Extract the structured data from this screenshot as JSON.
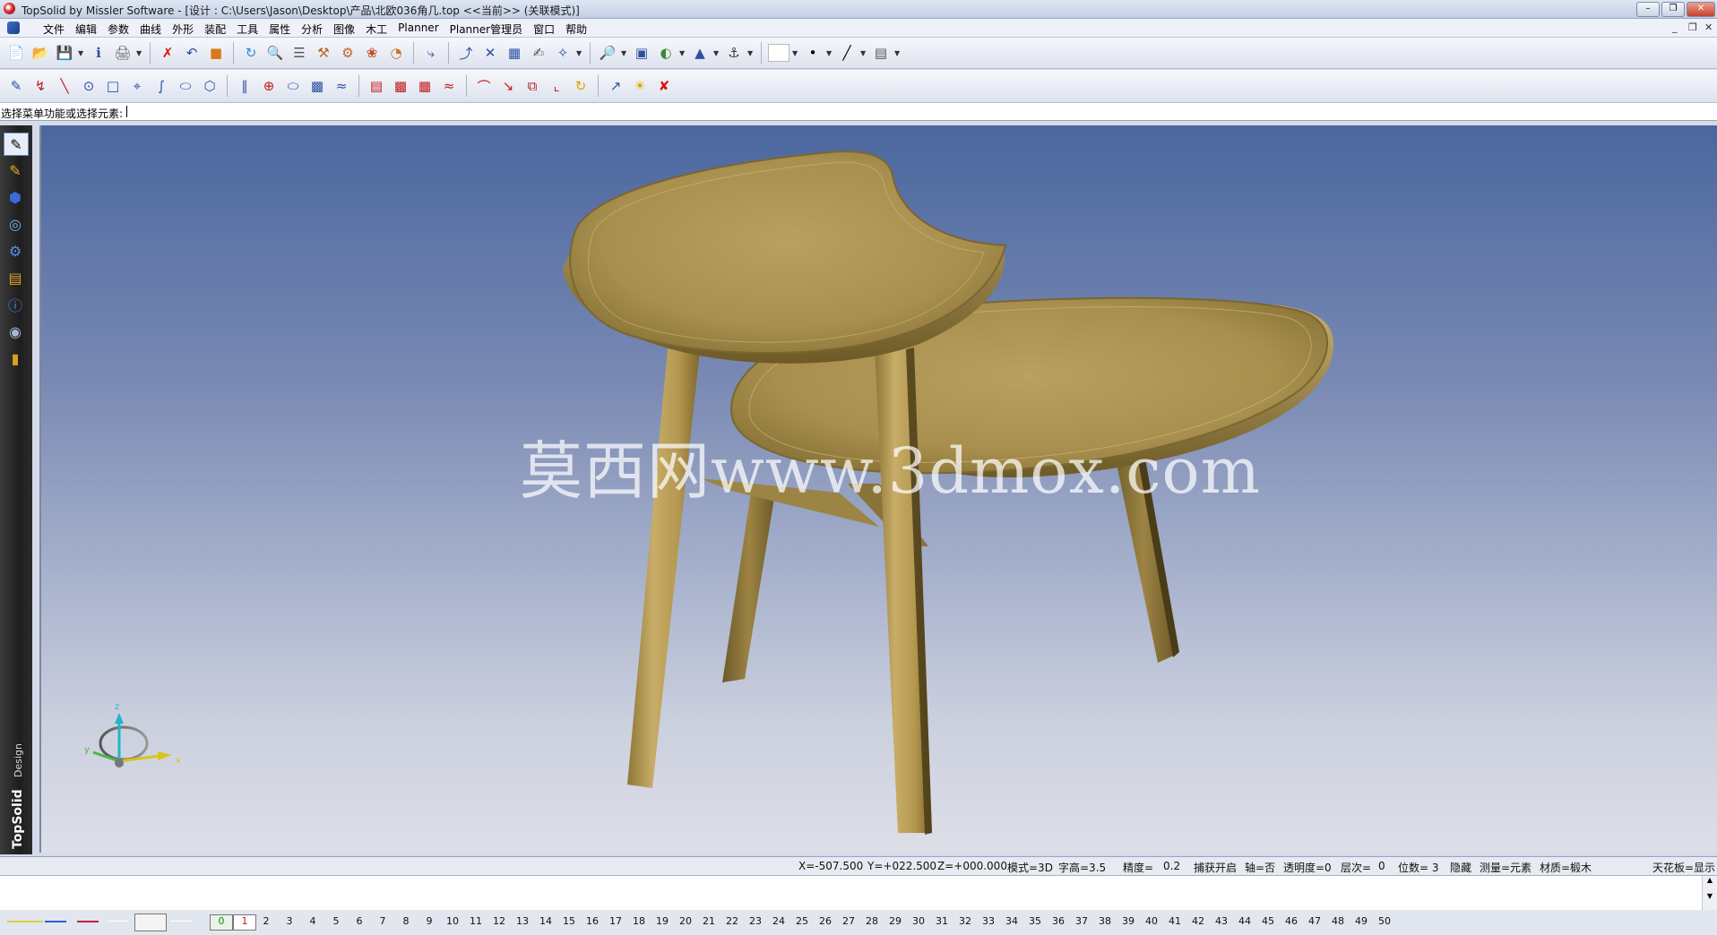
{
  "window": {
    "title": "TopSolid by Missler Software - [设计 : C:\\Users\\Jason\\Desktop\\产品\\北欧036角几.top  <<当前>> (关联模式)]",
    "min": "–",
    "restore": "❐",
    "close": "✕"
  },
  "menu": {
    "items": [
      "文件",
      "编辑",
      "参数",
      "曲线",
      "外形",
      "装配",
      "工具",
      "属性",
      "分析",
      "图像",
      "木工",
      "Planner",
      "Planner管理员",
      "窗口",
      "帮助"
    ],
    "mdi_min": "_",
    "mdi_restore": "❐",
    "mdi_close": "✕"
  },
  "command": {
    "prompt": "选择菜单功能或选择元素:"
  },
  "viewport": {
    "watermark": "莫西网www.3dmox.com",
    "axis": {
      "z": "z",
      "y": "y",
      "x": "x"
    },
    "brand": "TopSolid",
    "brand_sub": "Design"
  },
  "status": {
    "x": "X=-507.500",
    "y": "Y=+022.500",
    "z": "Z=+000.000",
    "mode": "模式=3D",
    "font_height": "字高=3.5",
    "precision_label": "精度=",
    "precision_value": "0.2",
    "snap": "捕获开启",
    "axis": "轴=否",
    "transparency": "透明度=0",
    "layer_label": "层次=",
    "layer_value": "0",
    "digits": "位数= 3",
    "hidden": "隐藏",
    "measure": "测量=元素",
    "material": "材质=椴木",
    "ceiling": "天花板=显示"
  },
  "layers": {
    "current": [
      "0",
      "1"
    ],
    "numbers": [
      "2",
      "3",
      "4",
      "5",
      "6",
      "7",
      "8",
      "9",
      "10",
      "11",
      "12",
      "13",
      "14",
      "15",
      "16",
      "17",
      "18",
      "19",
      "20",
      "21",
      "22",
      "23",
      "24",
      "25",
      "26",
      "27",
      "28",
      "29",
      "30",
      "31",
      "32",
      "33",
      "34",
      "35",
      "36",
      "37",
      "38",
      "39",
      "40",
      "41",
      "42",
      "43",
      "44",
      "45",
      "46",
      "47",
      "48",
      "49",
      "50"
    ]
  },
  "colors": {
    "viewport_top": "#4a679f",
    "viewport_bottom": "#dddfe8",
    "wood": "#b59a54",
    "wood_dark": "#7f6a32",
    "wood_light": "#cdb574"
  }
}
